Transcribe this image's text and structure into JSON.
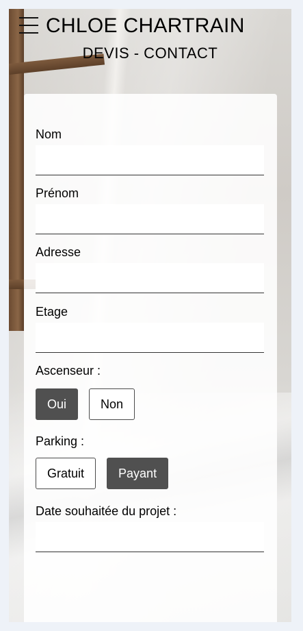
{
  "header": {
    "title": "CHLOE CHARTRAIN",
    "subtitle": "DEVIS - CONTACT"
  },
  "form": {
    "nom": {
      "label": "Nom",
      "value": ""
    },
    "prenom": {
      "label": "Prénom",
      "value": ""
    },
    "adresse": {
      "label": "Adresse",
      "value": ""
    },
    "etage": {
      "label": "Etage",
      "value": ""
    },
    "ascenseur": {
      "label": "Ascenseur :",
      "options": [
        "Oui",
        "Non"
      ],
      "selected": "Oui"
    },
    "parking": {
      "label": "Parking :",
      "options": [
        "Gratuit",
        "Payant"
      ],
      "selected": "Payant"
    },
    "date": {
      "label": "Date souhaitée du projet :",
      "value": ""
    }
  }
}
